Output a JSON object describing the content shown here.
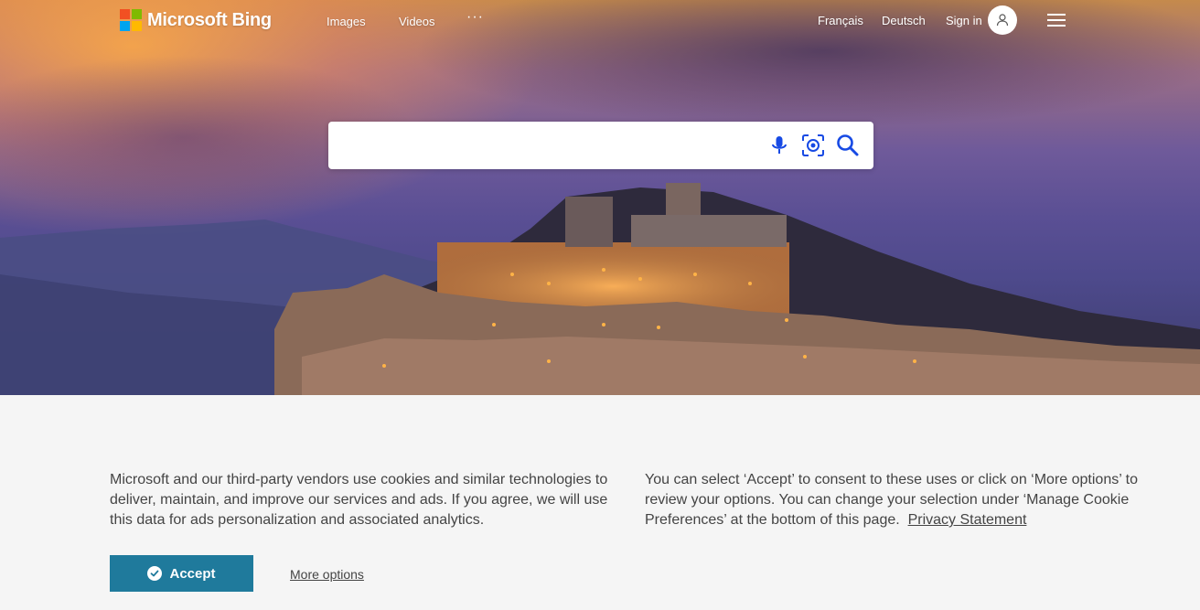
{
  "header": {
    "brand": "Microsoft Bing",
    "nav": {
      "images": "Images",
      "videos": "Videos",
      "more": "···"
    },
    "languages": [
      "Français",
      "Deutsch"
    ],
    "signin": "Sign in"
  },
  "search": {
    "placeholder": "",
    "value": ""
  },
  "cookie": {
    "left_text": "Microsoft and our third-party vendors use cookies and similar technologies to deliver, maintain, and improve our services and ads. If you agree, we will use this data for ads personalization and associated analytics.",
    "right_text": "You can select ‘Accept’ to consent to these uses or click on ‘More options’ to review your options.  You can change your selection under ‘Manage Cookie Preferences’ at the bottom of this page.",
    "privacy_link": "Privacy Statement",
    "accept_label": "Accept",
    "more_options_label": "More options"
  },
  "colors": {
    "accept_button": "#1f7a9c",
    "search_icon": "#174ae4",
    "banner_bg": "#f5f5f5"
  },
  "icons": [
    "microsoft-logo",
    "user-icon",
    "hamburger-icon",
    "microphone-icon",
    "visual-search-icon",
    "search-icon",
    "checkmark-icon"
  ]
}
